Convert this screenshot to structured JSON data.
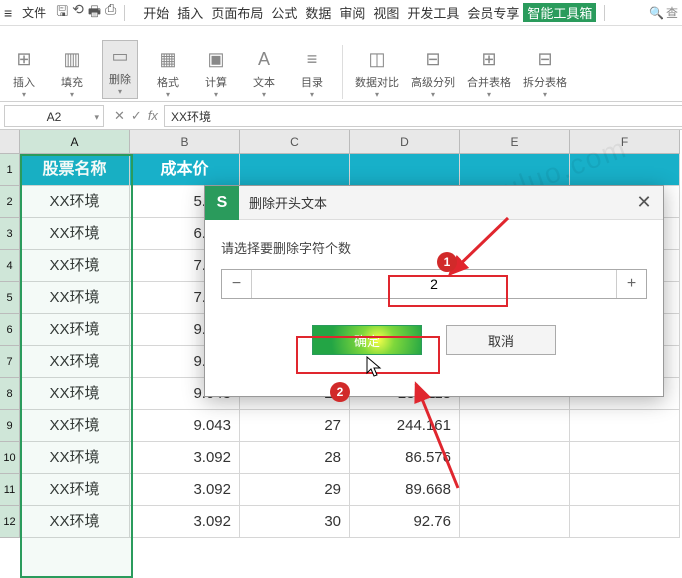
{
  "menubar": {
    "file": "文件",
    "tabs": [
      "开始",
      "插入",
      "页面布局",
      "公式",
      "数据",
      "审阅",
      "视图",
      "开发工具",
      "会员专享",
      "智能工具箱"
    ],
    "active_tab_index": 9,
    "search_hint": "查"
  },
  "ribbon": {
    "items": [
      {
        "label": "插入",
        "dd": true
      },
      {
        "label": "填充",
        "dd": true
      },
      {
        "label": "删除",
        "dd": true,
        "active": true
      },
      {
        "label": "格式",
        "dd": true
      },
      {
        "label": "计算",
        "dd": true
      },
      {
        "label": "文本",
        "dd": true
      },
      {
        "label": "目录",
        "dd": true
      },
      {
        "label": "数据对比",
        "dd": true
      },
      {
        "label": "高级分列",
        "dd": true
      },
      {
        "label": "合并表格",
        "dd": true
      },
      {
        "label": "拆分表格",
        "dd": true
      }
    ]
  },
  "formula_bar": {
    "name_box": "A2",
    "value": "XX环境"
  },
  "columns": [
    "A",
    "B",
    "C",
    "D",
    "E",
    "F"
  ],
  "selected_col_index": 0,
  "headers": {
    "A": "股票名称",
    "B": "成本价"
  },
  "rows": [
    {
      "n": "2",
      "A": "XX环境",
      "B": "5.089"
    },
    {
      "n": "3",
      "A": "XX环境",
      "B": "6.089"
    },
    {
      "n": "4",
      "A": "XX环境",
      "B": "7.045"
    },
    {
      "n": "5",
      "A": "XX环境",
      "B": "7.045"
    },
    {
      "n": "6",
      "A": "XX环境",
      "B": "9.043"
    },
    {
      "n": "7",
      "A": "XX环境",
      "B": "9.043"
    },
    {
      "n": "8",
      "A": "XX环境",
      "B": "9.043",
      "C": "26",
      "D": "235.118"
    },
    {
      "n": "9",
      "A": "XX环境",
      "B": "9.043",
      "C": "27",
      "D": "244.161"
    },
    {
      "n": "10",
      "A": "XX环境",
      "B": "3.092",
      "C": "28",
      "D": "86.576"
    },
    {
      "n": "11",
      "A": "XX环境",
      "B": "3.092",
      "C": "29",
      "D": "89.668"
    },
    {
      "n": "12",
      "A": "XX环境",
      "B": "3.092",
      "C": "30",
      "D": "92.76"
    }
  ],
  "dialog": {
    "title": "删除开头文本",
    "label": "请选择要删除字符个数",
    "value": "2",
    "ok": "确定",
    "cancel": "取消"
  },
  "badges": {
    "b1": "1",
    "b2": "2"
  },
  "watermark": "系统部落 www.xitongbuluo.com"
}
